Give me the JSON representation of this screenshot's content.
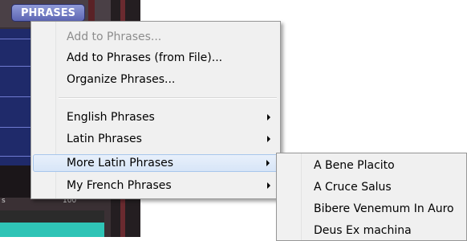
{
  "app": {
    "phrases_button": "PHRASES",
    "ruler_label": "s",
    "ruler_label2": "100"
  },
  "menu": {
    "items": [
      {
        "label": "Add to Phrases...",
        "enabled": false
      },
      {
        "label": "Add to Phrases (from File)...",
        "enabled": true
      },
      {
        "label": "Organize Phrases...",
        "enabled": true
      },
      {
        "label": "English Phrases",
        "submenu": true
      },
      {
        "label": "Latin Phrases",
        "submenu": true
      },
      {
        "label": "More Latin Phrases",
        "submenu": true,
        "highlighted": true
      },
      {
        "label": "My French Phrases",
        "submenu": true
      }
    ]
  },
  "submenu": {
    "items": [
      {
        "label": "A Bene Placito"
      },
      {
        "label": "A Cruce Salus"
      },
      {
        "label": "Bibere Venemum In Auro"
      },
      {
        "label": "Deus Ex machina"
      }
    ]
  },
  "colors": {
    "highlight": "#d7e5f7",
    "phrases_button": "#7a84cc",
    "teal_strip": "#2fc4b6"
  }
}
